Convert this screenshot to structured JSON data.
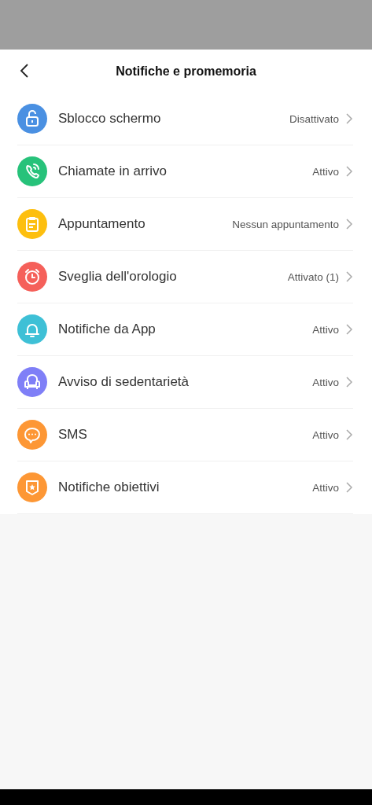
{
  "header": {
    "title": "Notifiche e promemoria"
  },
  "items": [
    {
      "kind": "lock",
      "color": "#4a90e2",
      "label": "Sblocco schermo",
      "value": "Disattivato"
    },
    {
      "kind": "phone",
      "color": "#27c27a",
      "label": "Chiamate in arrivo",
      "value": "Attivo"
    },
    {
      "kind": "clipboard",
      "color": "#fdbf0f",
      "label": "Appuntamento",
      "value": "Nessun appuntamento"
    },
    {
      "kind": "alarm",
      "color": "#f5605a",
      "label": "Sveglia dell'orologio",
      "value": "Attivato (1)"
    },
    {
      "kind": "bell",
      "color": "#3ec0d6",
      "label": "Notifiche da App",
      "value": "Attivo"
    },
    {
      "kind": "armchair",
      "color": "#7f7ff7",
      "label": "Avviso di sedentarietà",
      "value": "Attivo"
    },
    {
      "kind": "chat",
      "color": "#fd9735",
      "label": "SMS",
      "value": "Attivo"
    },
    {
      "kind": "shield",
      "color": "#fd9735",
      "label": "Notifiche obiettivi",
      "value": "Attivo"
    }
  ]
}
